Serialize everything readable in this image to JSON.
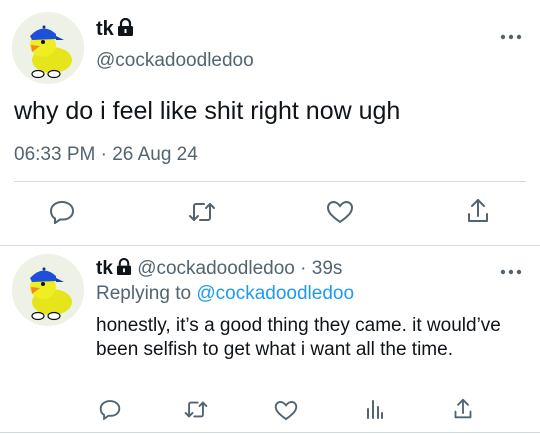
{
  "main_tweet": {
    "display_name": "tk",
    "handle": "@cockadoodledoo",
    "text": "why do i feel like shit right now ugh",
    "timestamp": "06:33 PM · 26 Aug 24",
    "avatar": "duck-with-cap-avatar",
    "protected_icon": "lock-icon",
    "actions": [
      "reply-icon",
      "retweet-icon",
      "like-icon",
      "share-icon"
    ]
  },
  "reply_tweet": {
    "display_name": "tk",
    "handle": "@cockadoodledoo",
    "separator": "·",
    "time_ago": "39s",
    "replying_label": "Replying to",
    "replying_handle": "@cockadoodledoo",
    "text": "honestly, it’s a good thing they came. it would’ve been selfish to get what i want all the time.",
    "avatar": "duck-with-cap-avatar",
    "actions": [
      "reply-icon",
      "retweet-icon",
      "like-icon",
      "analytics-icon",
      "share-icon"
    ]
  },
  "colors": {
    "text": "#0f1419",
    "secondary": "#536471",
    "link": "#1d9bf0",
    "divider": "#cfd9de",
    "icon": "#536471"
  }
}
